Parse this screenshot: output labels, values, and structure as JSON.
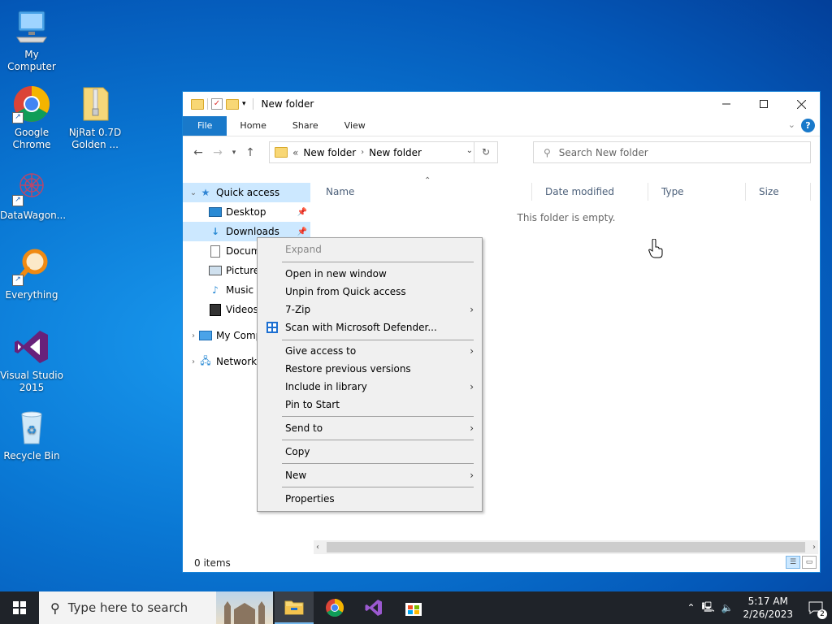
{
  "desktop": {
    "icons": [
      {
        "label": "My Computer",
        "icon": "computer-icon"
      },
      {
        "label": "Google Chrome",
        "icon": "chrome-icon"
      },
      {
        "label": "NjRat 0.7D Golden ...",
        "icon": "folder-zip-icon"
      },
      {
        "label": "DataWagon...",
        "icon": "datawagon-icon"
      },
      {
        "label": "Everything",
        "icon": "everything-search-icon"
      },
      {
        "label": "Visual Studio 2015",
        "icon": "visual-studio-icon"
      },
      {
        "label": "Recycle Bin",
        "icon": "recycle-bin-icon"
      }
    ]
  },
  "explorer": {
    "title": "New folder",
    "ribbon": {
      "tabs": [
        "File",
        "Home",
        "Share",
        "View"
      ],
      "help": "?"
    },
    "address": {
      "overflow": "«",
      "crumbs": [
        "New folder",
        "New folder"
      ]
    },
    "search_placeholder": "Search New folder",
    "nav": {
      "quick_access": "Quick access",
      "items": [
        {
          "label": "Desktop",
          "pinned": true
        },
        {
          "label": "Downloads",
          "pinned": true
        },
        {
          "label": "Documents",
          "pinned": false
        },
        {
          "label": "Pictures",
          "pinned": false
        },
        {
          "label": "Music",
          "pinned": false
        },
        {
          "label": "Videos",
          "pinned": false
        }
      ],
      "this_pc": "My Computer",
      "network": "Network"
    },
    "columns": [
      "Name",
      "Date modified",
      "Type",
      "Size"
    ],
    "empty_message": "This folder is empty.",
    "status": "0 items"
  },
  "context_menu": {
    "items": [
      {
        "label": "Expand",
        "disabled": true
      },
      {
        "label": "Open in new window"
      },
      {
        "label": "Unpin from Quick access"
      },
      {
        "label": "7-Zip",
        "submenu": true
      },
      {
        "label": "Scan with Microsoft Defender..."
      },
      {
        "label": "Give access to",
        "submenu": true
      },
      {
        "label": "Restore previous versions"
      },
      {
        "label": "Include in library",
        "submenu": true
      },
      {
        "label": "Pin to Start"
      },
      {
        "label": "Send to",
        "submenu": true
      },
      {
        "label": "Copy"
      },
      {
        "label": "New",
        "submenu": true
      },
      {
        "label": "Properties"
      }
    ]
  },
  "taskbar": {
    "search_placeholder": "Type here to search",
    "time": "5:17 AM",
    "date": "2/26/2023",
    "notification_count": "2"
  },
  "colors": {
    "accent": "#1979ca",
    "selection": "#cce8ff",
    "taskbar": "#1f2329"
  }
}
